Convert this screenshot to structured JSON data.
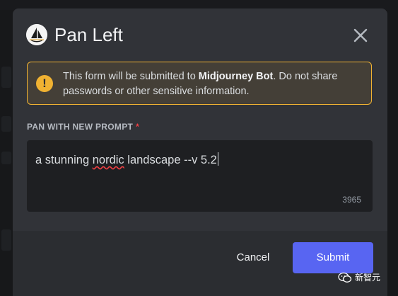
{
  "dialog": {
    "title": "Pan Left",
    "bot_avatar_icon": "sailboat-avatar-icon",
    "close_icon": "close-icon"
  },
  "warning": {
    "icon": "exclamation-icon",
    "text_before": "This form will be submitted to ",
    "bot_name": "Midjourney Bot",
    "text_after": ". Do not share passwords or other sensitive information."
  },
  "field": {
    "label": "PAN WITH NEW PROMPT",
    "required_mark": "*",
    "value_pre": "a stunning ",
    "value_misspelled": "nordic",
    "value_post": " landscape --v 5.2",
    "char_remaining": "3965"
  },
  "footer": {
    "cancel_label": "Cancel",
    "submit_label": "Submit"
  },
  "watermark": {
    "text": "新智元",
    "icon": "wechat-icon"
  },
  "colors": {
    "accent": "#5865f2",
    "warning": "#f0b232",
    "required": "#f23f43",
    "modal_bg": "#313338",
    "footer_bg": "#2b2d31"
  }
}
